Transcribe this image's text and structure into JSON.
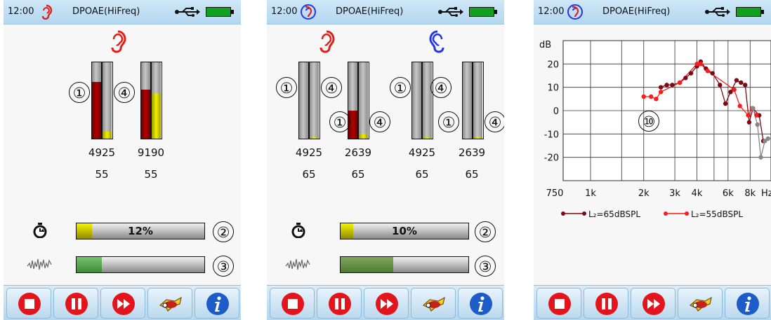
{
  "status": {
    "time": "12:00",
    "title": "DPOAE(HiFreq)"
  },
  "screen1": {
    "probes": [
      {
        "freq": "4925",
        "level": "55",
        "fill_a": 0.74,
        "fill_b": 0.09
      },
      {
        "freq": "9190",
        "level": "55",
        "fill_a": 0.64,
        "fill_b": 0.6
      }
    ],
    "markers": [
      "①",
      "④",
      "②",
      "③"
    ],
    "progress": {
      "text": "12%",
      "value": 0.12
    },
    "noise": {
      "value": 0.2
    }
  },
  "screen2": {
    "probes": [
      {
        "freq": "4925",
        "level": "65",
        "fill_a": 0.0,
        "fill_b": 0.02
      },
      {
        "freq": "2639",
        "level": "65",
        "fill_a": 0.37,
        "fill_b": 0.06
      },
      {
        "freq": "4925",
        "level": "65",
        "fill_a": 0.0,
        "fill_b": 0.02
      },
      {
        "freq": "2639",
        "level": "65",
        "fill_a": 0.0,
        "fill_b": 0.03
      }
    ],
    "markers": [
      "①",
      "④",
      "②",
      "③"
    ],
    "progress": {
      "text": "10%",
      "value": 0.1
    },
    "noise": {
      "value": 0.41
    }
  },
  "screen3": {
    "marker": "⑩"
  },
  "colors": {
    "red_ear": "#e0201a",
    "blue_ear": "#2436e0",
    "yellow": "#e8e400",
    "green": "#4ea04a",
    "dark_red": "#7a0a14",
    "red": "#ff1a1a"
  },
  "toolbar": {
    "icons": [
      "stop-icon",
      "pause-icon",
      "fast-forward-icon",
      "plane-icon",
      "info-icon"
    ]
  },
  "chart_data": {
    "type": "line",
    "ylabel": "dB",
    "xlabel": "Hz",
    "y_ticks": [
      "20",
      "10",
      "0",
      "-10",
      "-20"
    ],
    "ylim": [
      -30,
      30
    ],
    "x_ticks": [
      "750",
      "1k",
      "2k",
      "3k",
      "4k",
      "6k",
      "8k"
    ],
    "xlim_hz": [
      700,
      10500
    ],
    "grid": true,
    "legend_position": "bottom",
    "series": [
      {
        "name": "L₂=65dBSPL",
        "color": "#7a0a14",
        "points": [
          [
            2500,
            10
          ],
          [
            2700,
            11
          ],
          [
            2900,
            11
          ],
          [
            3200,
            12
          ],
          [
            3450,
            14
          ],
          [
            3700,
            16
          ],
          [
            4000,
            19
          ],
          [
            4200,
            21
          ],
          [
            4500,
            18
          ],
          [
            4900,
            16
          ],
          [
            5400,
            11
          ],
          [
            5800,
            3
          ],
          [
            6200,
            8
          ],
          [
            6700,
            13
          ],
          [
            7100,
            12
          ],
          [
            7500,
            11
          ],
          [
            7900,
            -5
          ],
          [
            8300,
            1
          ],
          [
            9000,
            -2
          ],
          [
            9500,
            -13
          ]
        ]
      },
      {
        "name": "L₂=55dBSPL",
        "color": "#ff1a1a",
        "points": [
          [
            2000,
            6
          ],
          [
            2200,
            6
          ],
          [
            2350,
            5
          ],
          [
            2500,
            8
          ],
          [
            3200,
            12
          ],
          [
            4000,
            20
          ],
          [
            4200,
            20
          ],
          [
            4600,
            17
          ],
          [
            6500,
            9
          ],
          [
            7000,
            2
          ],
          [
            7800,
            -2
          ],
          [
            8200,
            1
          ],
          [
            8700,
            -2
          ]
        ]
      },
      {
        "name": "",
        "color": "#888888",
        "points": [
          [
            8300,
            1
          ],
          [
            8800,
            -6
          ],
          [
            9200,
            -20
          ],
          [
            9700,
            -13
          ],
          [
            10100,
            -12
          ]
        ]
      }
    ]
  },
  "legend": {
    "l65": "L₂=65dBSPL",
    "l55": "L₂=55dBSPL"
  }
}
